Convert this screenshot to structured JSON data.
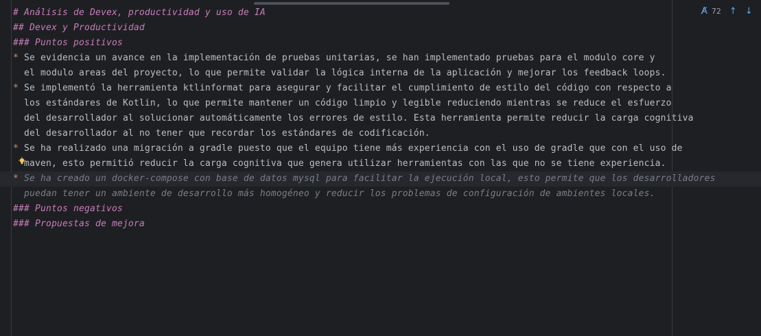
{
  "scrollbar": {},
  "inspections": {
    "icon": "spellcheck-icon",
    "count": "72",
    "prev": "↑",
    "next": "↓"
  },
  "lines": [
    {
      "kind": "header",
      "text": "# Análisis de Devex, productividad y uso de IA"
    },
    {
      "kind": "header",
      "text": "## Devex y Productividad"
    },
    {
      "kind": "header",
      "text": "### Puntos positivos"
    },
    {
      "kind": "bullet",
      "bullet": "*",
      "text": "Se evidencia un avance en la implementación de pruebas unitarias, se han implementado pruebas para el modulo core y"
    },
    {
      "kind": "cont",
      "text": "el modulo areas del proyecto, lo que permite validar la lógica interna de la aplicación y mejorar los feedback loops."
    },
    {
      "kind": "bullet",
      "bullet": "*",
      "text": "Se implementó la herramienta ktlinformat para asegurar y facilitar el cumplimiento de estilo del código con respecto a"
    },
    {
      "kind": "cont",
      "text": "los estándares de Kotlin, lo que permite mantener un código limpio y legible reduciendo mientras se reduce el esfuerzo"
    },
    {
      "kind": "cont",
      "text": "del desarrollador al solucionar automáticamente los errores de estilo. Esta herramienta permite reducir la carga cognitiva"
    },
    {
      "kind": "cont",
      "text": "del desarrollador al no tener que recordar los estándares de codificación."
    },
    {
      "kind": "bullet",
      "bullet": "*",
      "text": "Se ha realizado una migración a gradle puesto que el equipo tiene más experiencia con el uso de gradle que con el uso de"
    },
    {
      "kind": "cont",
      "text": "maven, esto permitió reducir la carga cognitiva que genera utilizar herramientas con las que no se tiene experiencia."
    },
    {
      "kind": "bullet-dim",
      "bullet": "*",
      "text": "Se ha creado un docker-compose con base de datos mysql para facilitar la ejecución local, esto permite que los desarrolladores"
    },
    {
      "kind": "cont-dim",
      "text": "puedan tener un ambiente de desarrollo más homogéneo y reducir los problemas de configuración de ambientes locales."
    },
    {
      "kind": "header",
      "text": "### Puntos negativos"
    },
    {
      "kind": "header",
      "text": "### Propuestas de mejora"
    }
  ]
}
